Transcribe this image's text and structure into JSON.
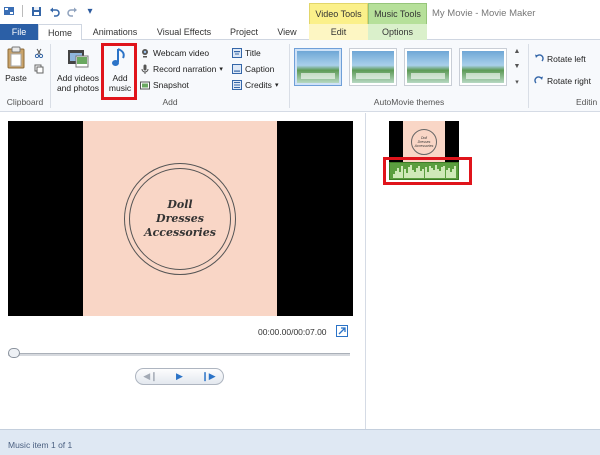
{
  "title_bar": {
    "window_title": "My Movie - Movie Maker",
    "context_tabs": {
      "video_tools": "Video Tools",
      "music_tools": "Music Tools"
    }
  },
  "tabs": {
    "file": "File",
    "home": "Home",
    "animations": "Animations",
    "visual_effects": "Visual Effects",
    "project": "Project",
    "view": "View",
    "edit": "Edit",
    "options": "Options"
  },
  "ribbon": {
    "clipboard": {
      "paste": "Paste",
      "group_label": "Clipboard"
    },
    "add": {
      "add_videos_line1": "Add videos",
      "add_videos_line2": "and photos",
      "add_music_line1": "Add",
      "add_music_line2": "music",
      "webcam_video": "Webcam video",
      "record_narration": "Record narration",
      "snapshot": "Snapshot",
      "title": "Title",
      "caption": "Caption",
      "credits": "Credits",
      "group_label": "Add"
    },
    "themes": {
      "group_label": "AutoMovie themes"
    },
    "editing": {
      "rotate_left": "Rotate left",
      "rotate_right": "Rotate right",
      "group_label": "Editin"
    }
  },
  "preview": {
    "card_text": [
      "Doll",
      "Dresses",
      "Accessories"
    ],
    "time": "00:00.00/00:07.00"
  },
  "storyboard": {
    "clip_text": [
      "Doll",
      "Dresses",
      "Accessories"
    ]
  },
  "status": {
    "text": "Music item 1 of 1"
  },
  "colors": {
    "file_tab": "#2b5fa6",
    "video_tools": "#fbf08a",
    "music_tools": "#b6e09a",
    "highlight": "#e0141b",
    "audio_clip": "#5b9e3f",
    "card_background": "#f9d6c6"
  },
  "icons": {
    "qat": [
      "app-icon",
      "save-icon",
      "undo-icon",
      "redo-icon",
      "dropdown-icon"
    ],
    "play": "play-icon",
    "previous_frame": "previous-frame-icon",
    "next_frame": "next-frame-icon",
    "fullscreen": "fullscreen-icon"
  }
}
